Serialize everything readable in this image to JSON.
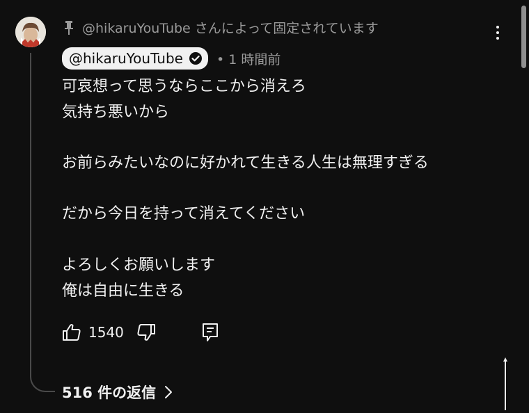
{
  "comment": {
    "pinned_text": "@hikaruYouTube さんによって固定されています",
    "author": "@hikaruYouTube",
    "time": "• 1 時間前",
    "lines": [
      "可哀想って思うならここから消えろ",
      "気持ち悪いから",
      "",
      "お前らみたいなのに好かれて生きる人生は無理すぎる",
      "",
      "だから今日を持って消えてください",
      "",
      "よろしくお願いします",
      "俺は自由に生きる"
    ],
    "like_count": "1540",
    "replies_label": "516 件の返信"
  },
  "icons": {
    "pin": "pin-icon",
    "verified": "verified-check-icon",
    "more": "more-vertical-icon",
    "like": "thumbs-up-icon",
    "dislike": "thumbs-down-icon",
    "reply": "reply-comment-icon",
    "chevron": "chevron-right-icon"
  },
  "colors": {
    "background": "#0f0f0f",
    "text": "#f1f1f1",
    "secondary": "#9a9a9a",
    "chip_bg": "#f1f1f1"
  }
}
